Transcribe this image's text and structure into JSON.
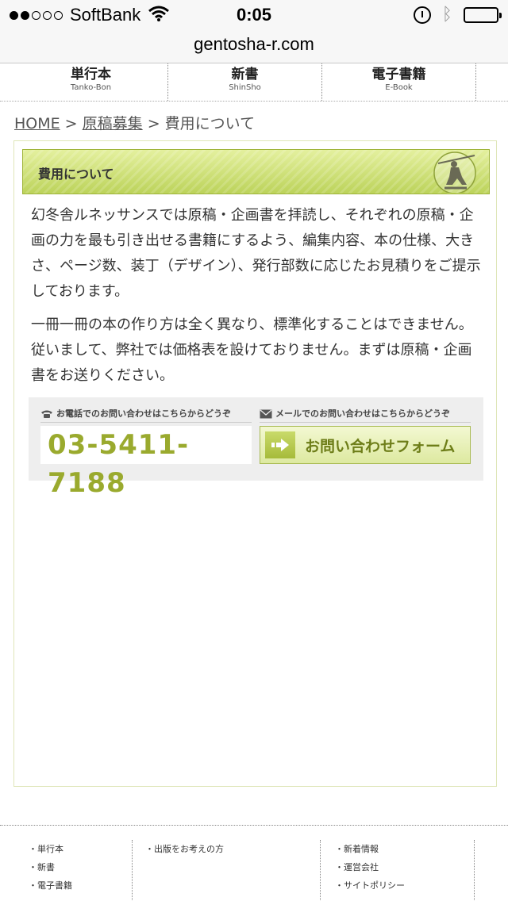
{
  "status_bar": {
    "carrier": "SoftBank",
    "time": "0:05",
    "signal_dots_filled": 2,
    "signal_dots_total": 5
  },
  "url_bar": {
    "url": "gentosha-r.com"
  },
  "top_nav": [
    {
      "label": "単行本",
      "sub": "Tanko-Bon"
    },
    {
      "label": "新書",
      "sub": "ShinSho"
    },
    {
      "label": "電子書籍",
      "sub": "E-Book"
    }
  ],
  "breadcrumb": {
    "home": "HOME",
    "sep1": " > ",
    "parent": "原稿募集",
    "sep2": " > ",
    "current": "費用について"
  },
  "main": {
    "heading": "費用について",
    "paragraph1": "幻冬舎ルネッサンスでは原稿・企画書を拝読し、それぞれの原稿・企画の力を最も引き出せる書籍にするよう、編集内容、本の仕様、大きさ、ページ数、装丁（デザイン）、発行部数に応じたお見積りをご提示しております。",
    "paragraph2": "一冊一冊の本の作り方は全く異なり、標準化することはできません。従いまして、弊社では価格表を設けておりません。まずは原稿・企画書をお送りください。"
  },
  "contact": {
    "phone_caption": "お電話でのお問い合わせはこちらからどうぞ",
    "phone_number": "03-5411-7188",
    "mail_caption": "メールでのお問い合わせはこちらからどうぞ",
    "form_button": "お問い合わせフォーム"
  },
  "footer": {
    "col1": [
      "単行本",
      "新書",
      "電子書籍"
    ],
    "col2": [
      "出版をお考えの方"
    ],
    "col3": [
      "新着情報",
      "運営会社",
      "サイトポリシー"
    ]
  },
  "colors": {
    "accent_green": "#9aaa2e",
    "heading_bar": "#c8dc6a"
  }
}
